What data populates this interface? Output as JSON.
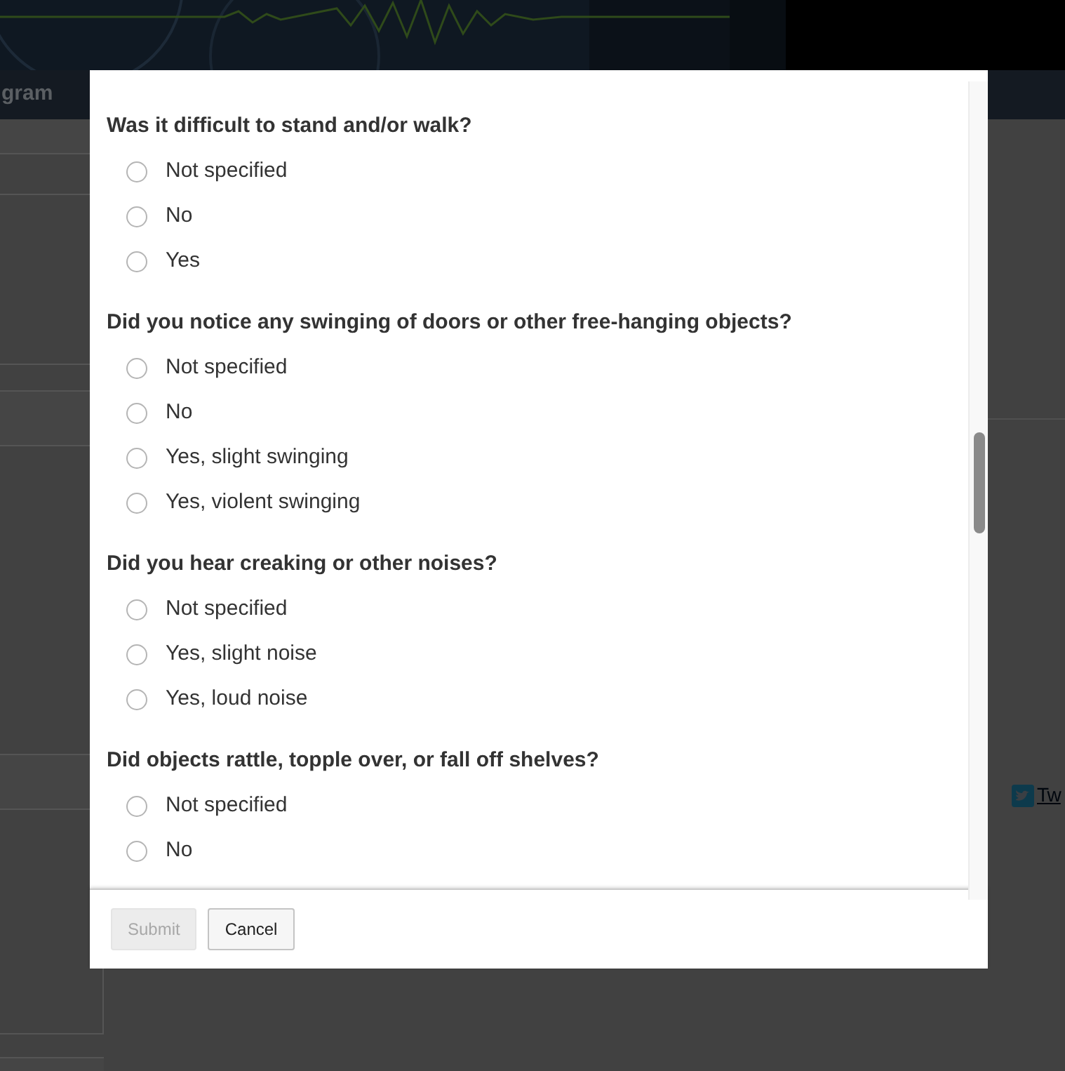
{
  "page": {
    "nav_text": "gram",
    "share_link": "Tw"
  },
  "questions": [
    {
      "title": "Was it difficult to stand and/or walk?",
      "options": [
        {
          "label": "Not specified",
          "selected": false
        },
        {
          "label": "No",
          "selected": false
        },
        {
          "label": "Yes",
          "selected": false
        }
      ]
    },
    {
      "title": "Did you notice any swinging of doors or other free-hanging objects?",
      "options": [
        {
          "label": "Not specified",
          "selected": false
        },
        {
          "label": "No",
          "selected": false
        },
        {
          "label": "Yes, slight swinging",
          "selected": false
        },
        {
          "label": "Yes, violent swinging",
          "selected": false
        }
      ]
    },
    {
      "title": "Did you hear creaking or other noises?",
      "options": [
        {
          "label": "Not specified",
          "selected": false
        },
        {
          "label": "Yes, slight noise",
          "selected": false
        },
        {
          "label": "Yes, loud noise",
          "selected": false
        }
      ]
    },
    {
      "title": "Did objects rattle, topple over, or fall off shelves?",
      "options": [
        {
          "label": "Not specified",
          "selected": false
        },
        {
          "label": "No",
          "selected": false
        }
      ]
    }
  ],
  "buttons": [
    {
      "label": "Submit",
      "disabled": true
    },
    {
      "label": "Cancel",
      "disabled": false
    }
  ]
}
